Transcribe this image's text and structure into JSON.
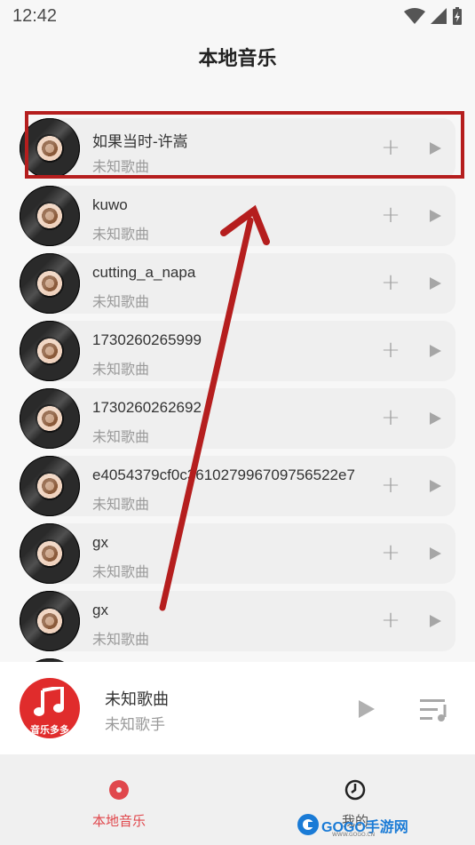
{
  "status_bar": {
    "time": "12:42"
  },
  "page_title": "本地音乐",
  "songs": [
    {
      "name": "如果当时-许嵩",
      "subtitle": "未知歌曲"
    },
    {
      "name": "kuwo",
      "subtitle": "未知歌曲"
    },
    {
      "name": "cutting_a_napa",
      "subtitle": "未知歌曲"
    },
    {
      "name": "1730260265999",
      "subtitle": "未知歌曲"
    },
    {
      "name": "1730260262692",
      "subtitle": "未知歌曲"
    },
    {
      "name": "e4054379cf0c361027996709756522e7",
      "subtitle": "未知歌曲"
    },
    {
      "name": "gx",
      "subtitle": "未知歌曲"
    },
    {
      "name": "gx",
      "subtitle": "未知歌曲"
    }
  ],
  "player": {
    "title": "未知歌曲",
    "artist": "未知歌手",
    "album_text": "音乐多多"
  },
  "nav": {
    "local_label": "本地音乐",
    "mine_label": "我的"
  },
  "watermark": {
    "brand": "GOGO手游网",
    "url": "WWW.GOGO.CN"
  },
  "colors": {
    "accent": "#e0474c",
    "annotation": "#b51e1e"
  }
}
